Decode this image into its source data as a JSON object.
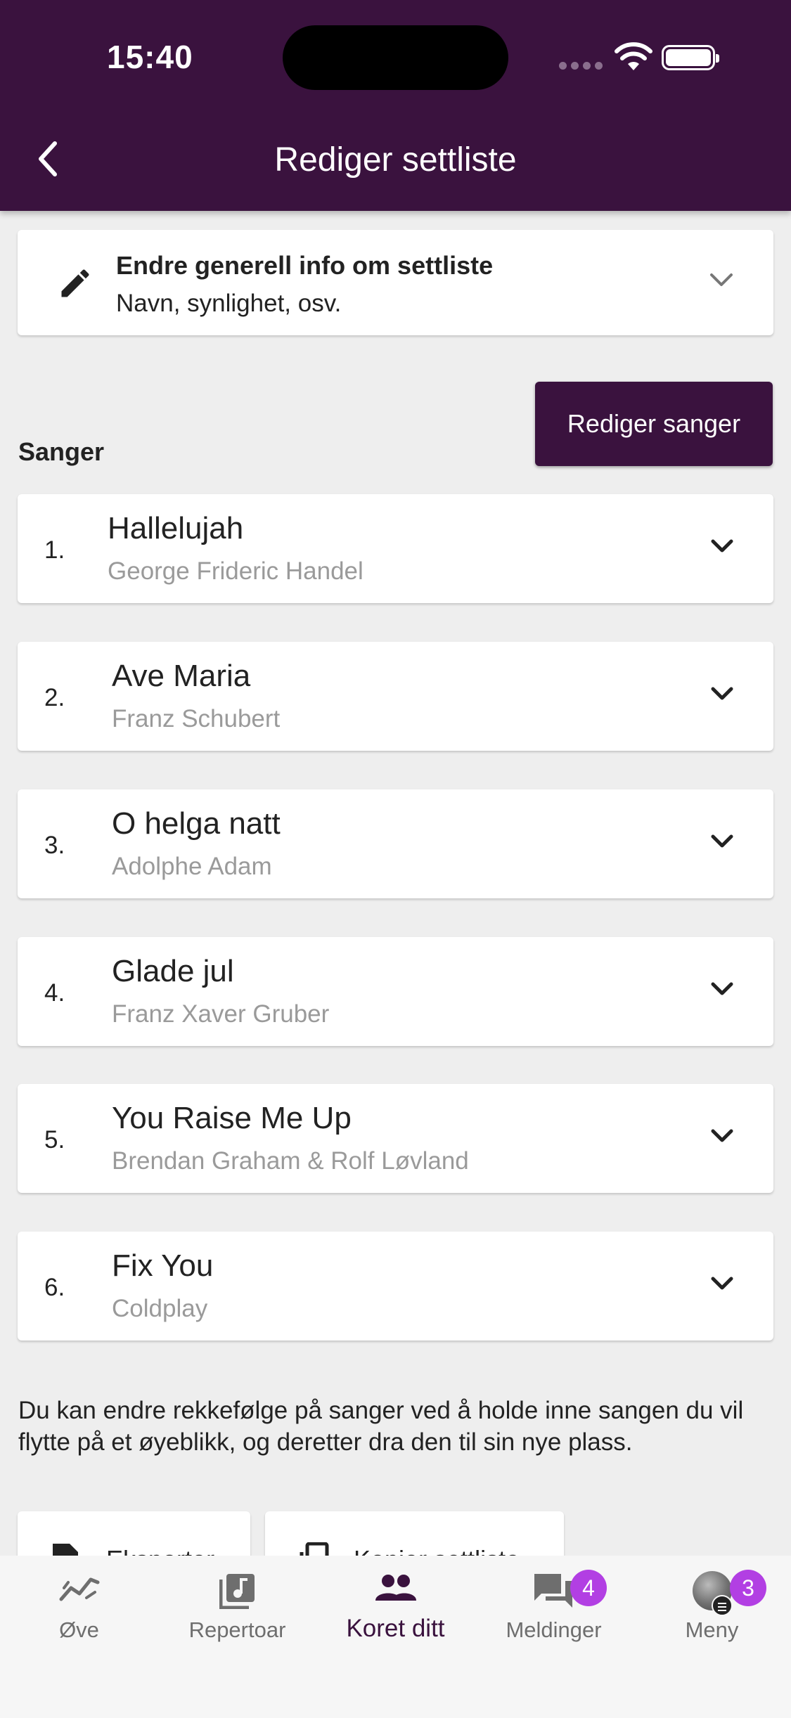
{
  "status_bar": {
    "time": "15:40"
  },
  "header": {
    "title": "Rediger settliste"
  },
  "info_card": {
    "title": "Endre generell info om settliste",
    "subtitle": "Navn, synlighet, osv."
  },
  "songs_section": {
    "label": "Sanger",
    "edit_button": "Rediger sanger",
    "songs": [
      {
        "number": "1.",
        "title": "Hallelujah",
        "composer": "George Frideric Handel"
      },
      {
        "number": "2.",
        "title": "Ave Maria",
        "composer": "Franz Schubert"
      },
      {
        "number": "3.",
        "title": "O helga natt",
        "composer": "Adolphe Adam"
      },
      {
        "number": "4.",
        "title": "Glade jul",
        "composer": "Franz Xaver Gruber"
      },
      {
        "number": "5.",
        "title": "You Raise Me Up",
        "composer": "Brendan Graham & Rolf Løvland"
      },
      {
        "number": "6.",
        "title": "Fix You",
        "composer": "Coldplay"
      }
    ],
    "hint": "Du kan endre rekkefølge på sanger ved å holde inne sangen du vil flytte på et øyeblikk, og deretter dra den til sin nye plass."
  },
  "actions": {
    "export": "Eksporter",
    "copy": "Kopier settliste"
  },
  "tabbar": {
    "tabs": [
      {
        "label": "Øve",
        "icon": "progress-chart-icon"
      },
      {
        "label": "Repertoar",
        "icon": "music-library-icon"
      },
      {
        "label": "Koret ditt",
        "icon": "group-icon",
        "active": true
      },
      {
        "label": "Meldinger",
        "icon": "chat-icon",
        "badge": "4"
      },
      {
        "label": "Meny",
        "icon": "avatar-menu-icon",
        "badge": "3"
      }
    ]
  },
  "colors": {
    "brand": "#3a123e",
    "badge": "#b23fe3",
    "background": "#eeeeee"
  }
}
